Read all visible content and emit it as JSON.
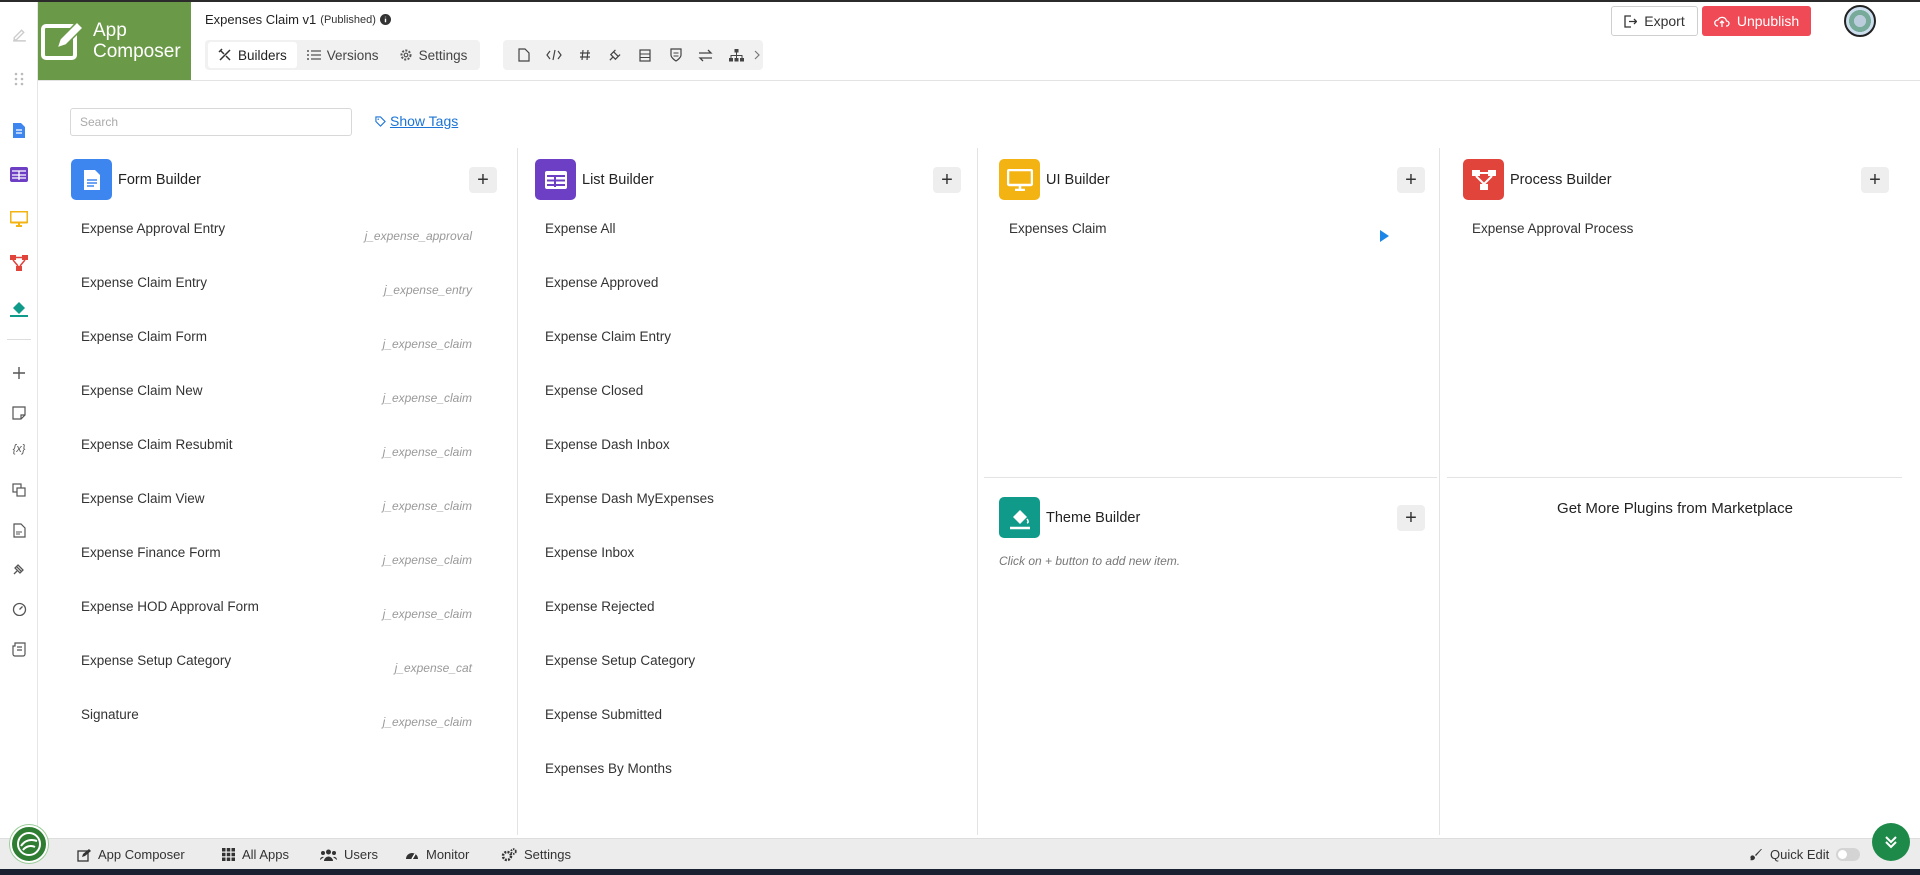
{
  "app": {
    "logo_line1": "App",
    "logo_line2": "Composer",
    "title": "Expenses Claim v1",
    "status": "(Published)"
  },
  "header_tabs": [
    {
      "label": "Builders",
      "icon": "tools-icon",
      "active": true
    },
    {
      "label": "Versions",
      "icon": "list-icon",
      "active": false
    },
    {
      "label": "Settings",
      "icon": "gear-icon",
      "active": false
    }
  ],
  "header_tools": [
    "file-icon",
    "code-icon",
    "hash-icon",
    "plugin-icon",
    "database-icon",
    "shield-icon",
    "transfer-icon",
    "sitemap-icon",
    "chevron-right-icon"
  ],
  "actions": {
    "export": "Export",
    "unpublish": "Unpublish"
  },
  "search": {
    "placeholder": "Search"
  },
  "show_tags": "Show Tags",
  "builders": {
    "form": {
      "title": "Form Builder",
      "color": "#3d86f0",
      "items": [
        {
          "name": "Expense Approval Entry",
          "tag": "j_expense_approval"
        },
        {
          "name": "Expense Claim Entry",
          "tag": "j_expense_entry"
        },
        {
          "name": "Expense Claim Form",
          "tag": "j_expense_claim"
        },
        {
          "name": "Expense Claim New",
          "tag": "j_expense_claim"
        },
        {
          "name": "Expense Claim Resubmit",
          "tag": "j_expense_claim"
        },
        {
          "name": "Expense Claim View",
          "tag": "j_expense_claim"
        },
        {
          "name": "Expense Finance Form",
          "tag": "j_expense_claim"
        },
        {
          "name": "Expense HOD Approval Form",
          "tag": "j_expense_claim"
        },
        {
          "name": "Expense Setup Category",
          "tag": "j_expense_cat"
        },
        {
          "name": "Signature",
          "tag": "j_expense_claim"
        }
      ]
    },
    "list": {
      "title": "List Builder",
      "color": "#6c3fc4",
      "items": [
        "Expense All",
        "Expense Approved",
        "Expense Claim Entry",
        "Expense Closed",
        "Expense Dash Inbox",
        "Expense Dash MyExpenses",
        "Expense Inbox",
        "Expense Rejected",
        "Expense Setup Category",
        "Expense Submitted",
        "Expenses By Months"
      ]
    },
    "ui": {
      "title": "UI Builder",
      "color": "#f2b313",
      "items": [
        "Expenses Claim"
      ]
    },
    "process": {
      "title": "Process Builder",
      "color": "#e0443b",
      "items": [
        "Expense Approval Process"
      ]
    },
    "theme": {
      "title": "Theme Builder",
      "color": "#0f9a8a",
      "empty_hint": "Click on + button to add new item."
    }
  },
  "marketplace": "Get More Plugins from Marketplace",
  "footer": {
    "items": [
      {
        "label": "App Composer",
        "icon": "edit-icon"
      },
      {
        "label": "All Apps",
        "icon": "grid-icon"
      },
      {
        "label": "Users",
        "icon": "users-icon"
      },
      {
        "label": "Monitor",
        "icon": "gauge-icon"
      },
      {
        "label": "Settings",
        "icon": "cogs-icon"
      }
    ],
    "quick_edit": "Quick Edit"
  }
}
